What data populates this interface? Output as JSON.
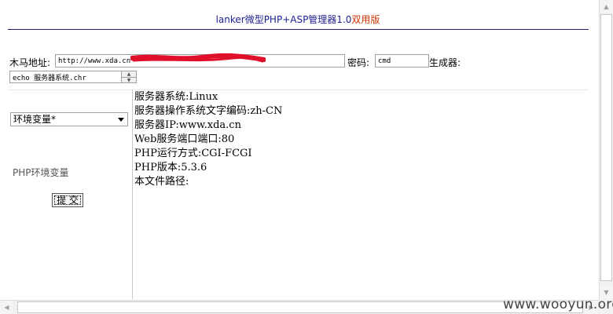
{
  "header": {
    "title": "lanker微型PHP+ASP管理器1.0",
    "edition": "双用版"
  },
  "form": {
    "url_label": "木马地址:",
    "url_value": "http://www.xda.cn",
    "password_label": "密码:",
    "password_value": "cmd",
    "generator_label": "生成器:",
    "command_value": "echo 服务器系统.chr"
  },
  "sidebar": {
    "selected_option": "环境变量*",
    "action_label": "PHP环境变量",
    "submit_label": "提 交"
  },
  "output": {
    "lines": [
      "服务器系统:Linux",
      "服务器操作系统文字编码:zh-CN",
      "服务器IP:www.xda.cn",
      "Web服务端口端口:80",
      "PHP运行方式:CGI-FCGI",
      "PHP版本:5.3.6",
      "本文件路径:"
    ]
  },
  "watermark": "www.wooyun.org",
  "colors": {
    "title": "#1f1f8f",
    "edition": "#cc3300",
    "redaction": "#e0102a"
  }
}
